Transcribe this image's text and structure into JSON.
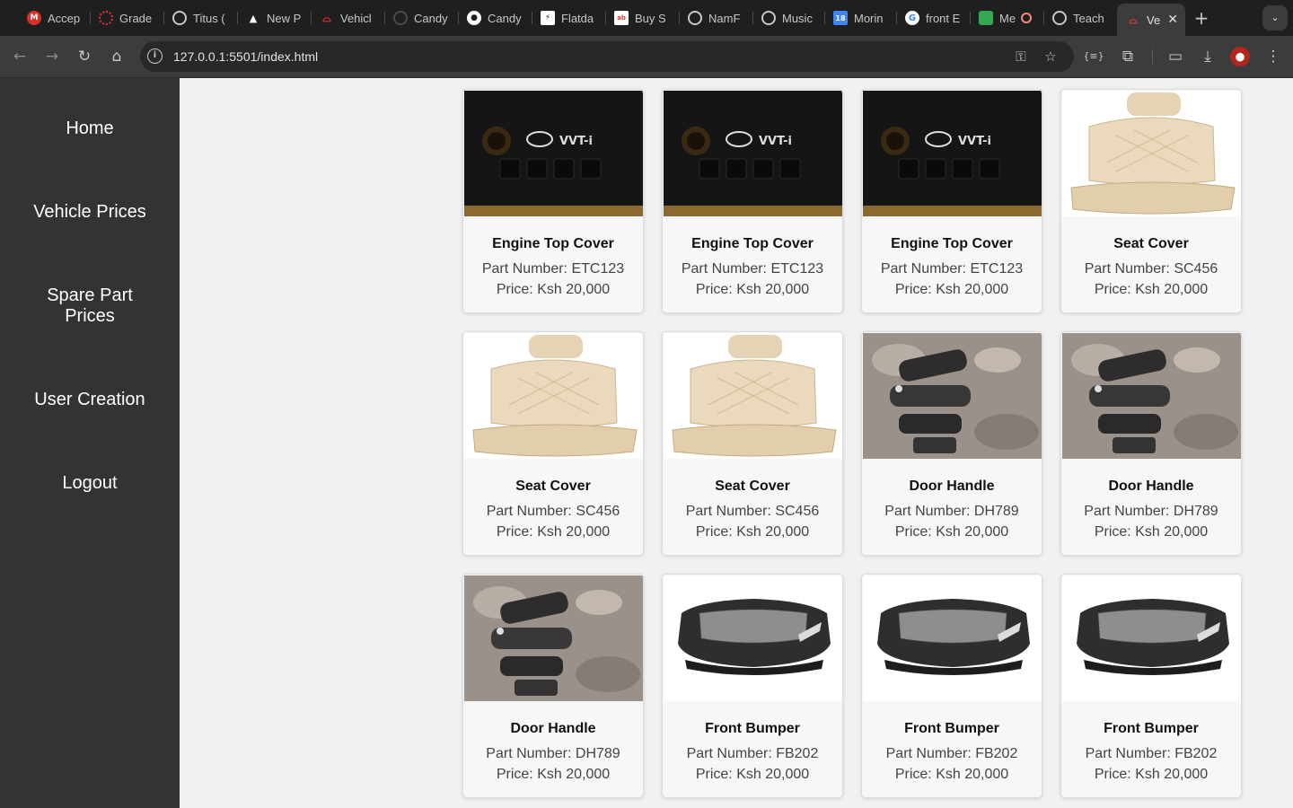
{
  "browser": {
    "tabs": [
      {
        "title": "Accep",
        "icon": "gmail-icon",
        "color": "#d93025"
      },
      {
        "title": "Grade",
        "icon": "circle-icon",
        "color": "#e53935"
      },
      {
        "title": "Titus (",
        "icon": "globe-icon",
        "color": "#9aa0a6"
      },
      {
        "title": "New P",
        "icon": "triangle-icon",
        "color": "#ffffff"
      },
      {
        "title": "Vehicl",
        "icon": "car-icon",
        "color": "#e53935"
      },
      {
        "title": "Candy",
        "icon": "spinner-icon",
        "color": "#5f6368"
      },
      {
        "title": "Candy",
        "icon": "github-icon",
        "color": "#ffffff"
      },
      {
        "title": "Flatda",
        "icon": "flatdash-icon",
        "color": "#ffffff"
      },
      {
        "title": "Buy S",
        "icon": "shop-icon",
        "color": "#ffffff"
      },
      {
        "title": "NamF",
        "icon": "globe-icon",
        "color": "#9aa0a6"
      },
      {
        "title": "Music",
        "icon": "globe-icon",
        "color": "#9aa0a6"
      },
      {
        "title": "Morin",
        "icon": "calendar-icon",
        "color": "#4285f4"
      },
      {
        "title": "front E",
        "icon": "google-icon",
        "color": "#ffffff"
      },
      {
        "title": "Me",
        "icon": "meet-icon",
        "color": "#34a853"
      },
      {
        "title": "Teach",
        "icon": "globe-icon",
        "color": "#9aa0a6"
      },
      {
        "title": "Ve",
        "icon": "car-icon",
        "color": "#e53935"
      }
    ],
    "url": "127.0.0.1:5501/index.html"
  },
  "sidebar": {
    "items": [
      {
        "label": "Home"
      },
      {
        "label": "Vehicle Prices"
      },
      {
        "label": "Spare Part Prices"
      },
      {
        "label": "User Creation"
      },
      {
        "label": "Logout"
      }
    ]
  },
  "products": [
    {
      "name": "Engine Top Cover",
      "part_number": "Part Number: ETC123",
      "price": "Price: Ksh 20,000",
      "image": "engine-cover"
    },
    {
      "name": "Engine Top Cover",
      "part_number": "Part Number: ETC123",
      "price": "Price: Ksh 20,000",
      "image": "engine-cover"
    },
    {
      "name": "Engine Top Cover",
      "part_number": "Part Number: ETC123",
      "price": "Price: Ksh 20,000",
      "image": "engine-cover"
    },
    {
      "name": "Seat Cover",
      "part_number": "Part Number: SC456",
      "price": "Price: Ksh 20,000",
      "image": "seat-cover"
    },
    {
      "name": "Seat Cover",
      "part_number": "Part Number: SC456",
      "price": "Price: Ksh 20,000",
      "image": "seat-cover"
    },
    {
      "name": "Seat Cover",
      "part_number": "Part Number: SC456",
      "price": "Price: Ksh 20,000",
      "image": "seat-cover"
    },
    {
      "name": "Door Handle",
      "part_number": "Part Number: DH789",
      "price": "Price: Ksh 20,000",
      "image": "door-handle"
    },
    {
      "name": "Door Handle",
      "part_number": "Part Number: DH789",
      "price": "Price: Ksh 20,000",
      "image": "door-handle"
    },
    {
      "name": "Door Handle",
      "part_number": "Part Number: DH789",
      "price": "Price: Ksh 20,000",
      "image": "door-handle"
    },
    {
      "name": "Front Bumper",
      "part_number": "Part Number: FB202",
      "price": "Price: Ksh 20,000",
      "image": "front-bumper"
    },
    {
      "name": "Front Bumper",
      "part_number": "Part Number: FB202",
      "price": "Price: Ksh 20,000",
      "image": "front-bumper"
    },
    {
      "name": "Front Bumper",
      "part_number": "Part Number: FB202",
      "price": "Price: Ksh 20,000",
      "image": "front-bumper"
    }
  ]
}
